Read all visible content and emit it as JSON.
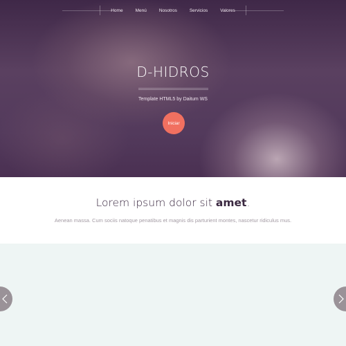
{
  "nav": {
    "items": [
      "Home",
      "Menú",
      "Nosotros",
      "Servicios",
      "Valores"
    ]
  },
  "hero": {
    "title": "D-HIDROS",
    "subtitle": "Template HTML5 by Daitum WS",
    "start_label": "Iniciar"
  },
  "intro": {
    "title_regular": "Lorem ipsum dolor sit ",
    "title_bold": "amet",
    "title_end": ".",
    "text": "Aenean massa. Cum sociis natoque penatibus et magnis dis parturient montes, nascetur ridiculus mus."
  },
  "slider": {
    "prev_icon": "chevron-left-icon",
    "next_icon": "chevron-right-icon"
  },
  "colors": {
    "accent": "#f17060",
    "hero_dark": "#3f2848",
    "section_bg": "#eef5f4"
  }
}
